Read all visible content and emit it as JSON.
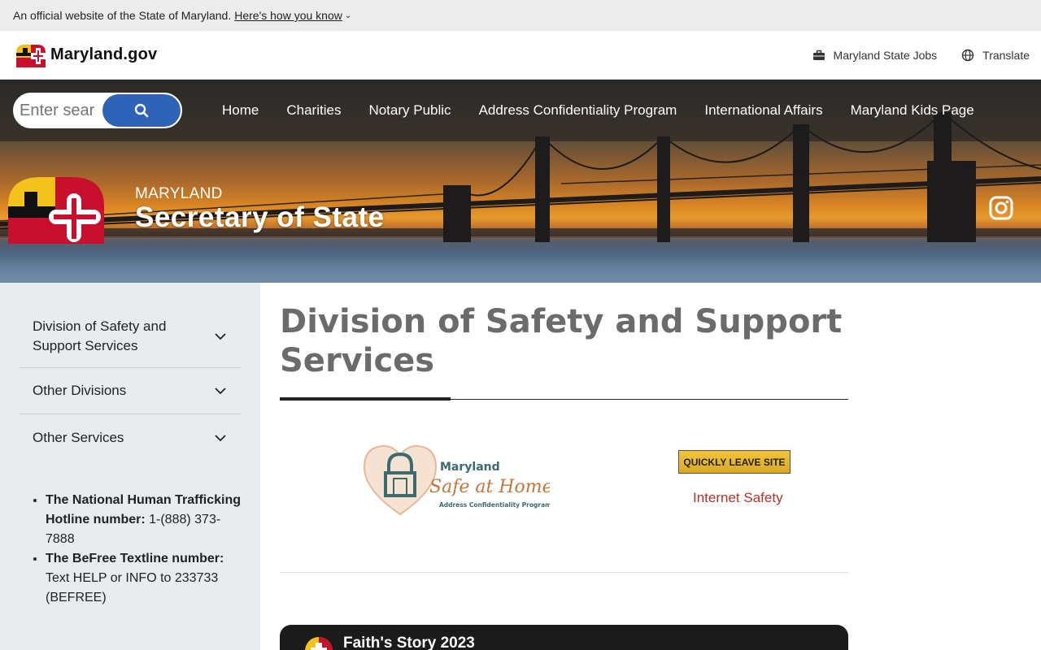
{
  "official_banner": {
    "text": "An official website of the State of Maryland.",
    "link": "Here's how you know",
    "chevron": "⌄"
  },
  "header": {
    "brand": "Maryland.gov",
    "links": [
      {
        "label": "Maryland State Jobs",
        "icon": "briefcase-icon"
      },
      {
        "label": "Translate",
        "icon": "globe-icon"
      }
    ]
  },
  "search": {
    "placeholder": "Enter search terms",
    "visible_placeholder": "Enter sear"
  },
  "main_nav": [
    "Home",
    "Charities",
    "Notary Public",
    "Address Confidentiality Program",
    "International Affairs",
    "Maryland Kids Page"
  ],
  "hero": {
    "kicker": "MARYLAND",
    "title": "Secretary of State",
    "social_icon": "instagram-icon"
  },
  "sidebar": {
    "items": [
      "Division of Safety and Support Services",
      "Other Divisions",
      "Other Services"
    ],
    "hotlines": [
      {
        "label": "The National Human Trafficking Hotline number:",
        "value": "1-(888) 373-7888"
      },
      {
        "label": "The BeFree Textline number:",
        "value": "Text HELP or INFO to 233733 (BEFREE)"
      }
    ]
  },
  "main": {
    "title": "Division of Safety and Support Services",
    "logo": {
      "line1": "Maryland",
      "line2": "Safe at Home",
      "line3": "Address Confidentiality Program"
    },
    "leave_button": "QUICKLY LEAVE SITE",
    "internet_link": "Internet Safety",
    "video_title": "Faith's Story 2023"
  },
  "colors": {
    "search_button": "#2f63b8",
    "link_red": "#b3312d",
    "leave_button": "#e0b02a",
    "sidebar_bg": "#e9ecef",
    "title_gray": "#6b6b6b"
  }
}
